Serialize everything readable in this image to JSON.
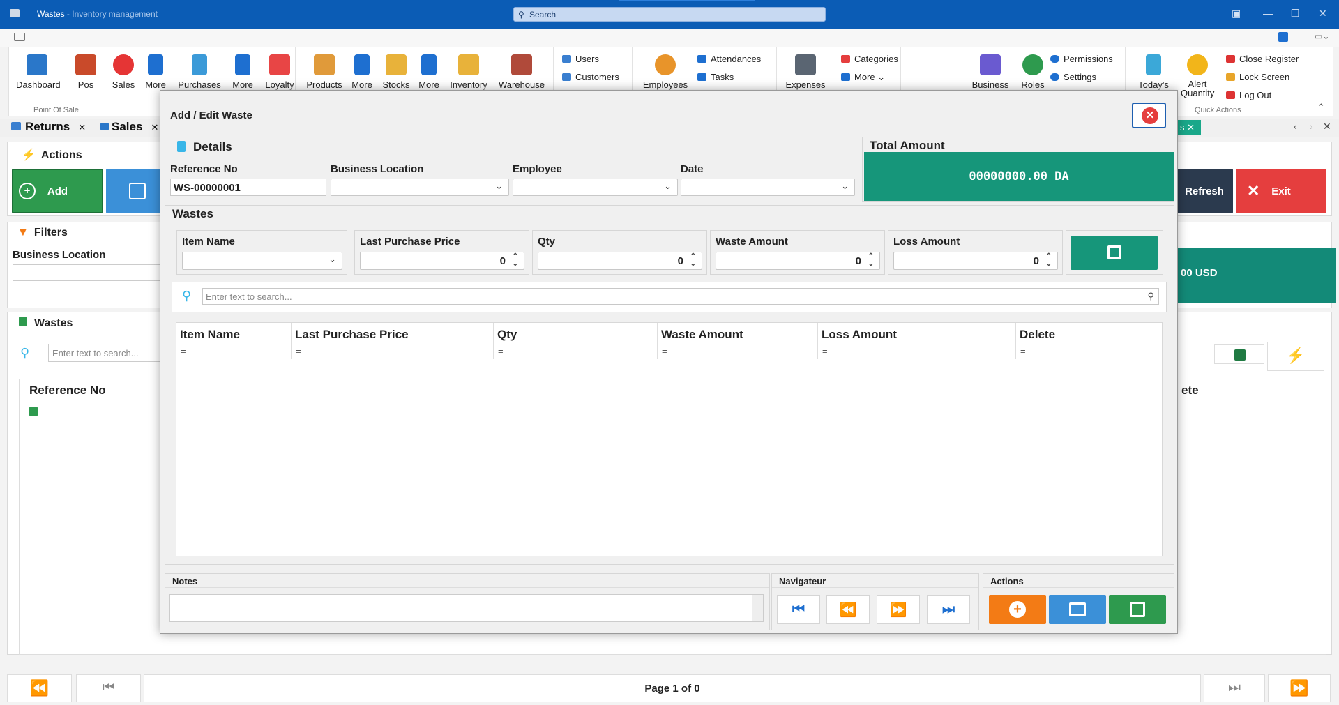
{
  "window": {
    "title": "Wastes",
    "subtitle": "- Inventory management",
    "search_placeholder": "Search"
  },
  "ribbon": {
    "pos_group": {
      "label": "Point Of Sale",
      "items": [
        "Dashboard",
        "Pos",
        "Sales",
        "More",
        "Purchases",
        "More",
        "Loyalty"
      ]
    },
    "inv_group": {
      "items": [
        "Products",
        "More",
        "Stocks",
        "More",
        "Inventory",
        "Warehouse"
      ]
    },
    "people": [
      "Users",
      "Customers"
    ],
    "employees": "Employees",
    "emp_small": [
      "Attendances",
      "Tasks"
    ],
    "expenses": "Expenses",
    "exp_small": [
      "Categories",
      "More"
    ],
    "business": "Business",
    "roles": "Roles",
    "admin_small": [
      "Permissions",
      "Settings"
    ],
    "quick_label": "Quick Actions",
    "todays": "Today's",
    "alert": [
      "Alert",
      "Quantity"
    ],
    "quick_small": [
      "Close Register",
      "Lock Screen",
      "Log Out"
    ]
  },
  "tabs": [
    {
      "label": "Returns"
    },
    {
      "label": "Sales"
    }
  ],
  "main": {
    "actions_title": "Actions",
    "add_label": "Add",
    "refresh_label": "Refresh",
    "exit_label": "Exit",
    "filters_title": "Filters",
    "business_location_label": "Business Location",
    "total_tail": "00 USD",
    "wastes_title": "Wastes",
    "search_placeholder": "Enter text to search...",
    "col_reference": "Reference No",
    "col_delete_tail": "ete",
    "pager_text": "Page 1 of 0"
  },
  "modal": {
    "title": "Add / Edit Waste",
    "details_title": "Details",
    "total_title": "Total Amount",
    "total_value": "00000000.00 DA",
    "fields": {
      "reference_label": "Reference No",
      "reference_value": "WS-00000001",
      "location_label": "Business Location",
      "employee_label": "Employee",
      "date_label": "Date"
    },
    "wastes_title": "Wastes",
    "entry": {
      "item_name": "Item Name",
      "last_price": "Last Purchase Price",
      "last_price_value": "0",
      "qty": "Qty",
      "qty_value": "0",
      "waste_amount": "Waste Amount",
      "waste_amount_value": "0",
      "loss_amount": "Loss Amount",
      "loss_amount_value": "0"
    },
    "search_placeholder": "Enter text to search...",
    "grid_columns": [
      "Item Name",
      "Last Purchase Price",
      "Qty",
      "Waste Amount",
      "Loss Amount",
      "Delete"
    ],
    "filter_symbol": "=",
    "notes_title": "Notes",
    "navigator_title": "Navigateur",
    "actions_title": "Actions"
  },
  "colors": {
    "accent": "#0b5cb5",
    "teal": "#16967a",
    "green": "#2e9a4e",
    "orange": "#f37b15",
    "blue": "#3b90d8",
    "red": "#e53e3e"
  }
}
